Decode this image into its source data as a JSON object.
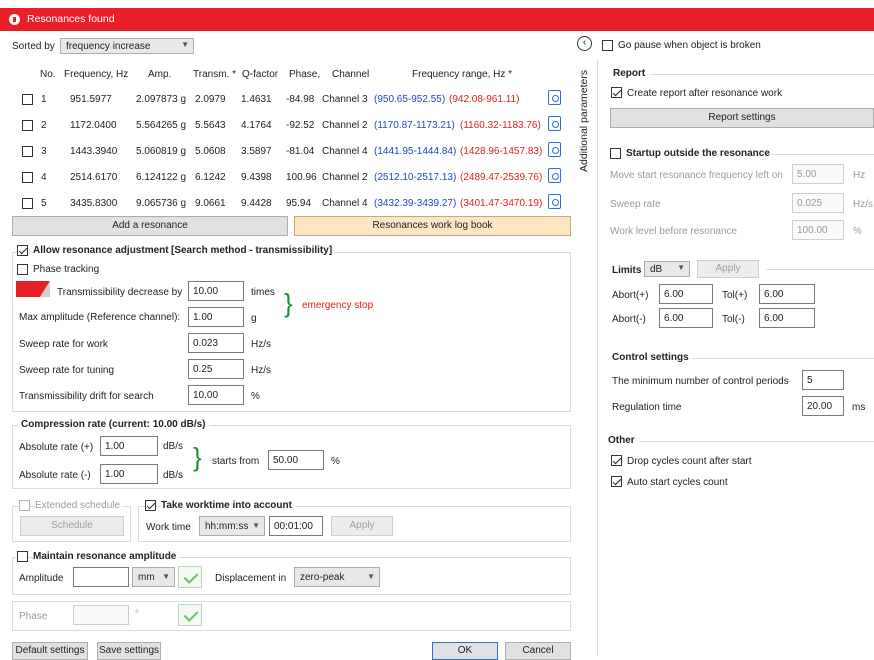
{
  "window": {
    "title": "Resonances found"
  },
  "sorted": {
    "label": "Sorted by",
    "value": "frequency increase"
  },
  "table": {
    "headers": {
      "no": "No.",
      "freq": "Frequency, Hz",
      "amp": "Amp.",
      "transm": "Transm. *",
      "q": "Q-factor",
      "phase": "Phase,",
      "channel": "Channel",
      "range": "Frequency range, Hz *"
    },
    "rows": [
      {
        "no": "1",
        "freq": "951.5977",
        "amp": "2.097873 g",
        "transm": "2.0979",
        "q": "1.4631",
        "phase": "-84.98",
        "channel": "Channel 3",
        "range_blue": "(950.65-952.55)",
        "range_red": "(942.08-961.11)"
      },
      {
        "no": "2",
        "freq": "1172.0400",
        "amp": "5.564265 g",
        "transm": "5.5643",
        "q": "4.1764",
        "phase": "-92.52",
        "channel": "Channel 2",
        "range_blue": "(1170.87-1173.21)",
        "range_red": "(1160.32-1183.76)"
      },
      {
        "no": "3",
        "freq": "1443.3940",
        "amp": "5.060819 g",
        "transm": "5.0608",
        "q": "3.5897",
        "phase": "-81.04",
        "channel": "Channel 4",
        "range_blue": "(1441.95-1444.84)",
        "range_red": "(1428.96-1457.83)"
      },
      {
        "no": "4",
        "freq": "2514.6170",
        "amp": "6.124122 g",
        "transm": "6.1242",
        "q": "9.4398",
        "phase": "100.96",
        "channel": "Channel 2",
        "range_blue": "(2512.10-2517.13)",
        "range_red": "(2489.47-2539.76)"
      },
      {
        "no": "5",
        "freq": "3435.8300",
        "amp": "9.065736 g",
        "transm": "9.0661",
        "q": "9.4428",
        "phase": "95.94",
        "channel": "Channel 4",
        "range_blue": "(3432.39-3439.27)",
        "range_red": "(3401.47-3470.19)"
      }
    ]
  },
  "buttons": {
    "add": "Add a resonance",
    "logbook": "Resonances work log book",
    "default": "Default settings",
    "save": "Save settings",
    "ok": "OK",
    "cancel": "Cancel",
    "schedule": "Schedule",
    "apply_worktime": "Apply",
    "report_settings": "Report settings",
    "apply_limits": "Apply"
  },
  "adjust": {
    "title": "Allow resonance adjustment",
    "method": "[Search method - transmissibility]",
    "phase_tracking": "Phase tracking",
    "transm_decrease": {
      "label": "Transmissibility decrease by",
      "value": "10.00",
      "unit": "times"
    },
    "max_amp": {
      "label": "Max amplitude (Reference channel):",
      "value": "1.00",
      "unit": "g"
    },
    "emergency": "emergency stop",
    "sweep_work": {
      "label": "Sweep rate for work",
      "value": "0.023",
      "unit": "Hz/s"
    },
    "sweep_tuning": {
      "label": "Sweep rate for tuning",
      "value": "0.25",
      "unit": "Hz/s"
    },
    "drift": {
      "label": "Transmissibility drift for search",
      "value": "10.00",
      "unit": "%"
    }
  },
  "compression": {
    "title": "Compression rate (current: 10.00 dB/s)",
    "abs_plus": {
      "label": "Absolute rate (+)",
      "value": "1.00",
      "unit": "dB/s"
    },
    "abs_minus": {
      "label": "Absolute rate (-)",
      "value": "1.00",
      "unit": "dB/s"
    },
    "starts_from": {
      "label": "starts from",
      "value": "50.00",
      "unit": "%"
    }
  },
  "schedule": {
    "extended": "Extended schedule",
    "take_worktime": "Take worktime into account",
    "worktime_label": "Work time",
    "format": "hh:mm:ss",
    "value": "00:01:00"
  },
  "maintain": {
    "title": "Maintain resonance amplitude",
    "amplitude_label": "Amplitude",
    "unit": "mm",
    "displacement_label": "Displacement in",
    "displacement_value": "zero-peak",
    "phase_label": "Phase",
    "phase_unit": "°"
  },
  "right": {
    "side_label": "Additional parameters",
    "go_pause": "Go pause when object is broken",
    "report": {
      "title": "Report",
      "create": "Create report after resonance work"
    },
    "startup": {
      "title": "Startup outside the resonance",
      "move_start": {
        "label": "Move start resonance frequency left on",
        "value": "5.00",
        "unit": "Hz"
      },
      "sweep": {
        "label": "Sweep rate",
        "value": "0.025",
        "unit": "Hz/s"
      },
      "work_level": {
        "label": "Work level before resonance",
        "value": "100.00",
        "unit": "%"
      }
    },
    "limits": {
      "title": "Limits",
      "unit": "dB",
      "abort_plus": {
        "label": "Abort(+)",
        "value": "6.00"
      },
      "tol_plus": {
        "label": "Tol(+)",
        "value": "6.00"
      },
      "abort_minus": {
        "label": "Abort(-)",
        "value": "6.00"
      },
      "tol_minus": {
        "label": "Tol(-)",
        "value": "6.00"
      }
    },
    "control": {
      "title": "Control settings",
      "min_periods": {
        "label": "The minimum number of control periods",
        "value": "5"
      },
      "regulation": {
        "label": "Regulation time",
        "value": "20.00",
        "unit": "ms"
      }
    },
    "other": {
      "title": "Other",
      "drop_cycles": "Drop cycles count after start",
      "auto_start": "Auto start cycles count"
    }
  },
  "colors": {
    "title_bar": "#e8202a",
    "range_blue": "#2046c8",
    "range_red": "#e02020",
    "emergency": "#e02020",
    "brace": "#1e8c3a",
    "logbook_bg": "#fce6c4"
  }
}
